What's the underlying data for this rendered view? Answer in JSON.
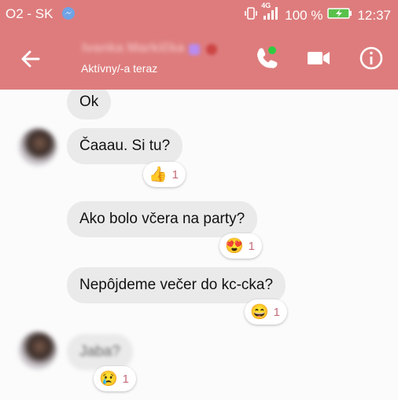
{
  "status_bar": {
    "carrier": "O2 - SK",
    "battery": "100 %",
    "time": "12:37",
    "network": "4G"
  },
  "header": {
    "contact_name": "Ivanka Markíčka",
    "status": "Aktívny/-a teraz"
  },
  "messages": [
    {
      "text": "Ok",
      "reaction": null,
      "count": null
    },
    {
      "text": "Čaaau. Si tu?",
      "reaction": "👍",
      "count": "1"
    },
    {
      "text": "Ako bolo včera na party?",
      "reaction": "😍",
      "count": "1"
    },
    {
      "text": "Nepôjdeme večer do kc-cka?",
      "reaction": "😄",
      "count": "1"
    },
    {
      "text": "Jaba?",
      "reaction": "😢",
      "count": "1"
    }
  ],
  "colors": {
    "header": "#de7c7d",
    "bubble": "#eaeaea",
    "reaction_count": "#c36b78",
    "call_dot": "#2ecc40"
  }
}
